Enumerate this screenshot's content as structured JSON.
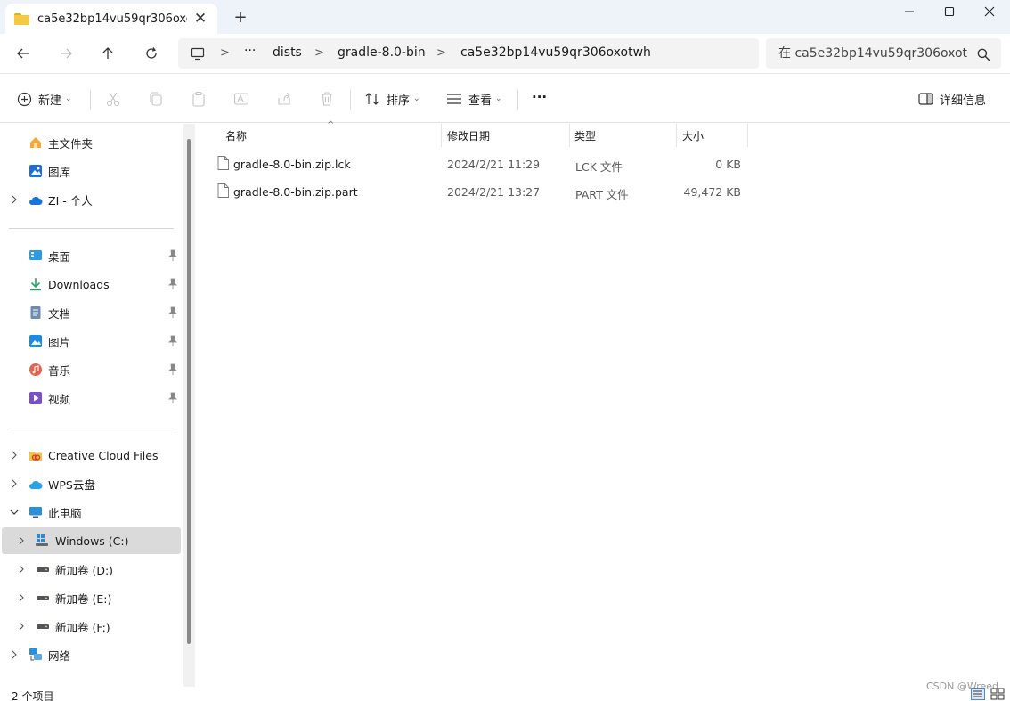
{
  "window": {
    "tab_title": "ca5e32bp14vu59qr306oxot",
    "tab_close_glyph": "✕",
    "new_tab_glyph": "+"
  },
  "address": {
    "ellipsis": "···",
    "crumbs": [
      "dists",
      "gradle-8.0-bin",
      "ca5e32bp14vu59qr306oxotwh"
    ],
    "separator": ">"
  },
  "search": {
    "placeholder": "在 ca5e32bp14vu59qr306oxot"
  },
  "toolbar": {
    "new_label": "新建",
    "sort_label": "排序",
    "view_label": "查看",
    "more_label": "···",
    "details_label": "详细信息"
  },
  "sidebar": {
    "quick": [
      {
        "label": "主文件夹",
        "icon": "home-icon"
      },
      {
        "label": "图库",
        "icon": "gallery-icon"
      },
      {
        "label": "ZI - 个人",
        "icon": "onedrive-icon",
        "expandable": true
      }
    ],
    "pinned": [
      {
        "label": "桌面",
        "icon": "desktop-icon"
      },
      {
        "label": "Downloads",
        "icon": "download-icon"
      },
      {
        "label": "文档",
        "icon": "document-icon"
      },
      {
        "label": "图片",
        "icon": "pictures-icon"
      },
      {
        "label": "音乐",
        "icon": "music-icon"
      },
      {
        "label": "视频",
        "icon": "video-icon"
      }
    ],
    "locations": [
      {
        "label": "Creative Cloud Files",
        "icon": "creative-cloud-icon"
      },
      {
        "label": "WPS云盘",
        "icon": "wps-cloud-icon"
      },
      {
        "label": "此电脑",
        "icon": "this-pc-icon",
        "expanded": true
      },
      {
        "label": "Windows (C:)",
        "icon": "windows-drive-icon",
        "selected": true
      },
      {
        "label": "新加卷 (D:)",
        "icon": "drive-icon"
      },
      {
        "label": "新加卷 (E:)",
        "icon": "drive-icon"
      },
      {
        "label": "新加卷 (F:)",
        "icon": "drive-icon"
      },
      {
        "label": "网络",
        "icon": "network-icon"
      }
    ]
  },
  "columns": {
    "name": "名称",
    "modified": "修改日期",
    "type": "类型",
    "size": "大小"
  },
  "files": [
    {
      "name": "gradle-8.0-bin.zip.lck",
      "modified": "2024/2/21 11:29",
      "type": "LCK 文件",
      "size": "0 KB"
    },
    {
      "name": "gradle-8.0-bin.zip.part",
      "modified": "2024/2/21 13:27",
      "type": "PART 文件",
      "size": "49,472 KB"
    }
  ],
  "status": {
    "count_text": "2 个项目",
    "watermark": "CSDN @Wreed"
  },
  "colors": {
    "accent": "#0067c0",
    "selected_bg": "#dadada",
    "titlebar_bg": "#eef2f9"
  }
}
